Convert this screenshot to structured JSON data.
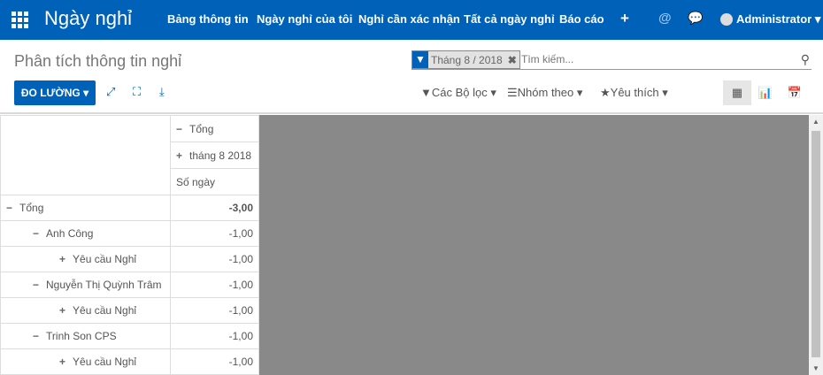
{
  "navbar": {
    "app_title": "Ngày nghỉ",
    "menu": [
      "Bảng thông tin",
      "Ngày nghỉ của tôi",
      "Nghỉ cần xác nhận",
      "Tất cả ngày nghỉ",
      "Báo cáo"
    ],
    "user": "Administrator",
    "accent": "#0061b8"
  },
  "control": {
    "title": "Phân tích thông tin nghỉ",
    "facet": "Tháng 8 / 2018",
    "search_placeholder": "Tìm kiếm...",
    "measures": "ĐO LƯỜNG",
    "filters": "Các Bộ lọc",
    "group_by": "Nhóm theo",
    "favorites": "Yêu thích"
  },
  "pivot": {
    "col_headers": [
      "Tổng",
      "tháng 8 2018",
      "Số ngày"
    ],
    "rows": [
      {
        "label": "Tổng",
        "sign": "−",
        "level": 0,
        "value": "-3,00"
      },
      {
        "label": "Anh Công",
        "sign": "−",
        "level": 1,
        "value": "-1,00"
      },
      {
        "label": "Yêu cầu Nghỉ",
        "sign": "+",
        "level": 2,
        "value": "-1,00"
      },
      {
        "label": "Nguyễn Thị Quỳnh Trâm",
        "sign": "−",
        "level": 1,
        "value": "-1,00"
      },
      {
        "label": "Yêu cầu Nghỉ",
        "sign": "+",
        "level": 2,
        "value": "-1,00"
      },
      {
        "label": "Trinh Son CPS",
        "sign": "−",
        "level": 1,
        "value": "-1,00"
      },
      {
        "label": "Yêu cầu Nghỉ",
        "sign": "+",
        "level": 2,
        "value": "-1,00"
      }
    ]
  }
}
